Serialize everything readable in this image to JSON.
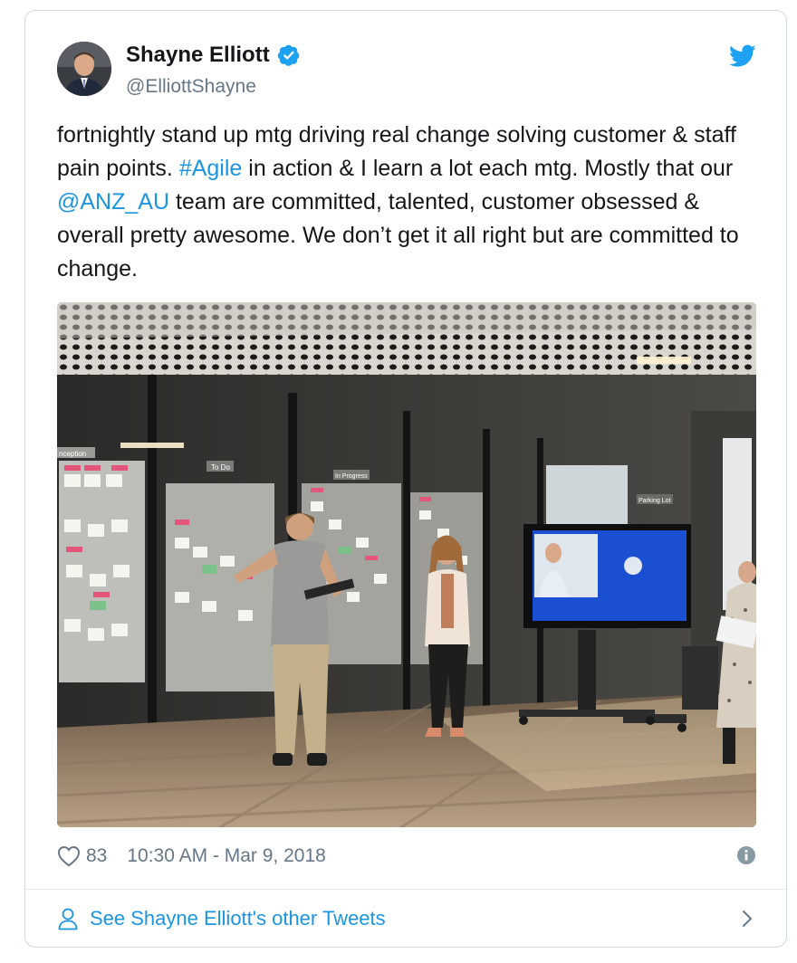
{
  "author": {
    "name": "Shayne Elliott",
    "handle": "@ElliottShayne",
    "verified": true
  },
  "tweet": {
    "segments": [
      {
        "text": "fortnightly stand up mtg driving real change solving customer & staff pain points. ",
        "type": "plain"
      },
      {
        "text": "#Agile",
        "type": "hashtag"
      },
      {
        "text": " in action & I learn a lot each mtg. Mostly that our ",
        "type": "plain"
      },
      {
        "text": "@ANZ_AU",
        "type": "mention"
      },
      {
        "text": " team are committed, talented, customer obsessed & overall pretty awesome. We don’t get it all right but are committed to change.",
        "type": "plain"
      }
    ]
  },
  "media": {
    "wall_signs": [
      "nception",
      "To Do",
      "In Progress",
      "Parking Lot"
    ]
  },
  "meta": {
    "likes": "83",
    "timestamp": "10:30 AM - Mar 9, 2018"
  },
  "footer": {
    "label": "See Shayne Elliott's other Tweets"
  },
  "colors": {
    "link": "#1b95e0",
    "verified": "#1da1f2",
    "secondary_text": "#657786"
  },
  "icons": [
    "twitter-bird-icon",
    "verified-badge-icon",
    "heart-icon",
    "info-icon",
    "person-icon",
    "chevron-right-icon"
  ]
}
